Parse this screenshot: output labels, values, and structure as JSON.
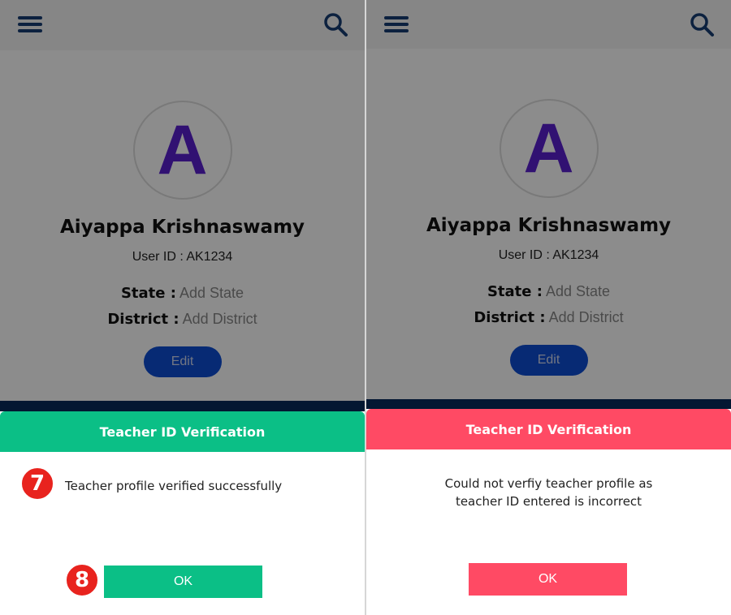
{
  "screens": [
    {
      "appbar": {
        "menu_icon": "hamburger-menu-icon",
        "search_icon": "search-icon"
      },
      "profile": {
        "avatar_letter": "A",
        "name": "Aiyappa Krishnaswamy",
        "user_id": "User ID : AK1234",
        "state_label": "State :",
        "state_value": "Add State",
        "district_label": "District :",
        "district_value": "Add District",
        "edit_label": "Edit"
      },
      "dialog": {
        "title": "Teacher ID Verification",
        "message": "Teacher profile verified successfully",
        "button": "OK",
        "header_color": "#0bbf86"
      },
      "markers": [
        "7",
        "8"
      ]
    },
    {
      "appbar": {
        "menu_icon": "hamburger-menu-icon",
        "search_icon": "search-icon"
      },
      "profile": {
        "avatar_letter": "A",
        "name": "Aiyappa Krishnaswamy",
        "user_id": "User ID : AK1234",
        "state_label": "State :",
        "state_value": "Add State",
        "district_label": "District :",
        "district_value": "Add District",
        "edit_label": "Edit"
      },
      "dialog": {
        "title": "Teacher ID Verification",
        "message_line1": "Could not verfiy teacher profile as",
        "message_line2": "teacher ID entered is incorrect",
        "button": "OK",
        "header_color": "#ff4a64"
      }
    }
  ],
  "colors": {
    "navy": "#163d73",
    "avatar_letter": "#5a1fd0",
    "edit_button": "#0d4ed4",
    "success": "#0bbf86",
    "error": "#ff4a64",
    "marker": "#e8231e"
  }
}
